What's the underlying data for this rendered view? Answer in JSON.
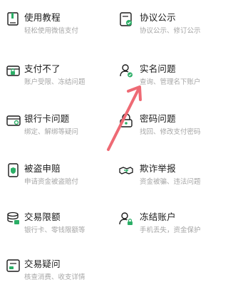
{
  "colors": {
    "accent": "#2bae66",
    "arrow": "#ee6a74",
    "title": "#1a1a1a",
    "subtitle": "#a6a6a6"
  },
  "items": [
    {
      "title": "使用教程",
      "subtitle": "轻松使用微信支付",
      "icon": "book-icon"
    },
    {
      "title": "协议公示",
      "subtitle": "协议公示、修订公示",
      "icon": "agreement-icon"
    },
    {
      "title": "支付不了",
      "subtitle": "账户受限、冻结问题",
      "icon": "wallet-lock-icon"
    },
    {
      "title": "实名问题",
      "subtitle": "查询、管理名下账户",
      "icon": "user-verified-icon"
    },
    {
      "title": "银行卡问题",
      "subtitle": "绑定、解绑等疑问",
      "icon": "bank-card-icon"
    },
    {
      "title": "密码问题",
      "subtitle": "找回、修改支付密码",
      "icon": "lock-icon"
    },
    {
      "title": "被盗申赔",
      "subtitle": "申请资金被盗赔付",
      "icon": "phone-shield-icon"
    },
    {
      "title": "欺诈举报",
      "subtitle": "资金被骗、违法问题",
      "icon": "fraud-report-icon"
    },
    {
      "title": "交易限额",
      "subtitle": "银行卡、零钱限额等",
      "icon": "coins-stack-icon"
    },
    {
      "title": "冻结账户",
      "subtitle": "手机丢失，资金保护",
      "icon": "user-lock-icon"
    },
    {
      "title": "交易疑问",
      "subtitle": "核查消费、收支详情",
      "icon": "receipt-icon"
    }
  ]
}
